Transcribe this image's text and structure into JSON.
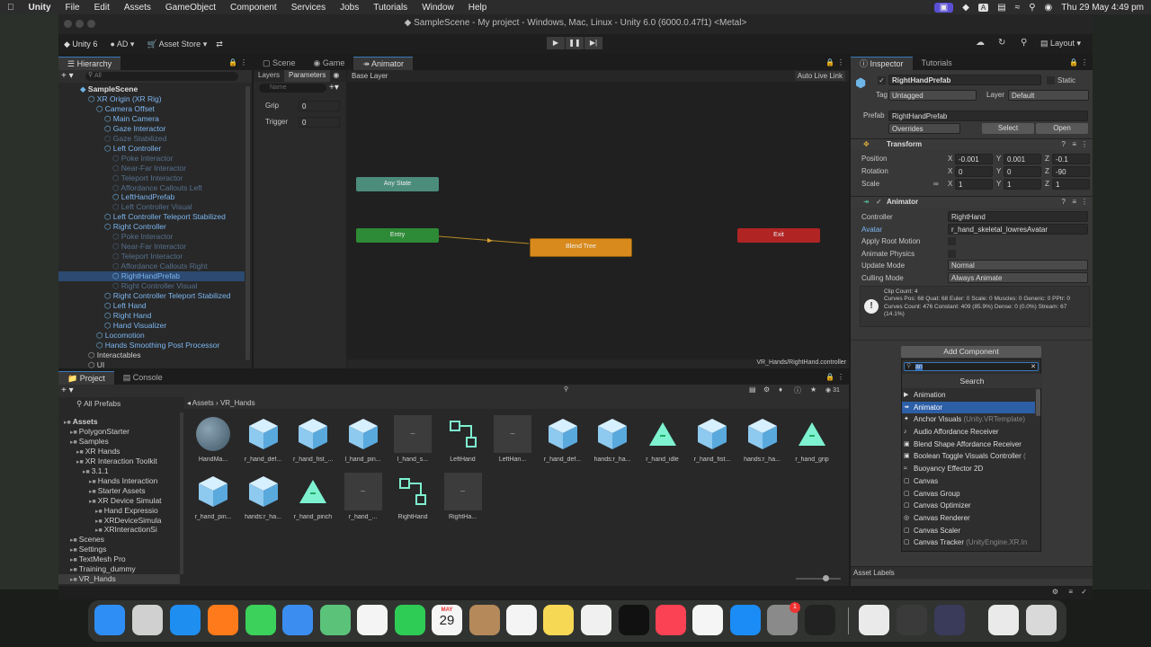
{
  "menubar": {
    "app": "Unity",
    "items": [
      "File",
      "Edit",
      "Assets",
      "GameObject",
      "Component",
      "Services",
      "Jobs",
      "Tutorials",
      "Window",
      "Help"
    ],
    "datetime": "Thu 29 May  4:49 pm"
  },
  "window": {
    "title": "SampleScene - My project - Windows, Mac, Linux - Unity 6.0 (6000.0.47f1) <Metal>"
  },
  "toolbar": {
    "unity": "Unity 6",
    "account": "AD",
    "asset_store": "Asset Store",
    "layout": "Layout"
  },
  "hierarchy": {
    "tab": "Hierarchy",
    "search_placeholder": "All",
    "items": [
      {
        "label": "SampleScene",
        "depth": 0,
        "style": "scene"
      },
      {
        "label": "XR Origin (XR Rig)",
        "depth": 1,
        "style": "blue"
      },
      {
        "label": "Camera Offset",
        "depth": 2,
        "style": "blue"
      },
      {
        "label": "Main Camera",
        "depth": 3,
        "style": "blue"
      },
      {
        "label": "Gaze Interactor",
        "depth": 3,
        "style": "blue"
      },
      {
        "label": "Gaze Stabilized",
        "depth": 3,
        "style": "dim"
      },
      {
        "label": "Left Controller",
        "depth": 3,
        "style": "blue"
      },
      {
        "label": "Poke Interactor",
        "depth": 4,
        "style": "dim"
      },
      {
        "label": "Near-Far Interactor",
        "depth": 4,
        "style": "dim"
      },
      {
        "label": "Teleport Interactor",
        "depth": 4,
        "style": "dim"
      },
      {
        "label": "Affordance Callouts Left",
        "depth": 4,
        "style": "dim"
      },
      {
        "label": "LeftHandPrefab",
        "depth": 4,
        "style": "blue"
      },
      {
        "label": "Left Controller Visual",
        "depth": 4,
        "style": "dim"
      },
      {
        "label": "Left Controller Teleport Stabilized",
        "depth": 3,
        "style": "blue"
      },
      {
        "label": "Right Controller",
        "depth": 3,
        "style": "blue"
      },
      {
        "label": "Poke Interactor",
        "depth": 4,
        "style": "dim"
      },
      {
        "label": "Near-Far Interactor",
        "depth": 4,
        "style": "dim"
      },
      {
        "label": "Teleport Interactor",
        "depth": 4,
        "style": "dim"
      },
      {
        "label": "Affordance Callouts Right",
        "depth": 4,
        "style": "dim"
      },
      {
        "label": "RightHandPrefab",
        "depth": 4,
        "style": "blue sel"
      },
      {
        "label": "Right Controller Visual",
        "depth": 4,
        "style": "dim"
      },
      {
        "label": "Right Controller Teleport Stabilized",
        "depth": 3,
        "style": "blue"
      },
      {
        "label": "Left Hand",
        "depth": 3,
        "style": "blue"
      },
      {
        "label": "Right Hand",
        "depth": 3,
        "style": "blue"
      },
      {
        "label": "Hand Visualizer",
        "depth": 3,
        "style": "blue"
      },
      {
        "label": "Locomotion",
        "depth": 2,
        "style": "blue"
      },
      {
        "label": "Hands Smoothing Post Processor",
        "depth": 2,
        "style": "blue"
      },
      {
        "label": "Interactables",
        "depth": 1,
        "style": "plain"
      },
      {
        "label": "UI",
        "depth": 1,
        "style": "plain"
      }
    ]
  },
  "animator": {
    "tabs": [
      "Scene",
      "Game",
      "Animator"
    ],
    "subtabs": [
      "Layers",
      "Parameters"
    ],
    "base_layer": "Base Layer",
    "auto_live_link": "Auto Live Link",
    "search_placeholder": "Name",
    "parameters": [
      {
        "name": "Grip",
        "value": "0"
      },
      {
        "name": "Trigger",
        "value": "0"
      }
    ],
    "nodes": {
      "any_state": "Any State",
      "entry": "Entry",
      "blend_tree": "Blend Tree",
      "exit": "Exit"
    },
    "footer": "VR_Hands/RightHand.controller"
  },
  "project": {
    "tabs": [
      "Project",
      "Console"
    ],
    "favorites": "All Prefabs",
    "breadcrumb": [
      "Assets",
      "VR_Hands"
    ],
    "count": "31",
    "tree": [
      {
        "label": "Assets",
        "depth": 0
      },
      {
        "label": "PolygonStarter",
        "depth": 1
      },
      {
        "label": "Samples",
        "depth": 1
      },
      {
        "label": "XR Hands",
        "depth": 2
      },
      {
        "label": "XR Interaction Toolkit",
        "depth": 2
      },
      {
        "label": "3.1.1",
        "depth": 3
      },
      {
        "label": "Hands Interaction",
        "depth": 4
      },
      {
        "label": "Starter Assets",
        "depth": 4
      },
      {
        "label": "XR Device Simulat",
        "depth": 4
      },
      {
        "label": "Hand Expressio",
        "depth": 5
      },
      {
        "label": "XRDeviceSimula",
        "depth": 5
      },
      {
        "label": "XRInteractionSi",
        "depth": 5
      },
      {
        "label": "Scenes",
        "depth": 1
      },
      {
        "label": "Settings",
        "depth": 1
      },
      {
        "label": "TextMesh Pro",
        "depth": 1
      },
      {
        "label": "Training_dummy",
        "depth": 1
      },
      {
        "label": "VR_Hands",
        "depth": 1
      }
    ],
    "assets": [
      {
        "label": "HandMa...",
        "kind": "sphere"
      },
      {
        "label": "r_hand_def...",
        "kind": "cube"
      },
      {
        "label": "r_hand_fist_...",
        "kind": "cube"
      },
      {
        "label": "l_hand_pin...",
        "kind": "cube"
      },
      {
        "label": "l_hand_s...",
        "kind": "anim"
      },
      {
        "label": "LeftHand",
        "kind": "ctrl"
      },
      {
        "label": "LeftHan...",
        "kind": "anim"
      },
      {
        "label": "r_hand_def...",
        "kind": "cube"
      },
      {
        "label": "hands:r_ha...",
        "kind": "cube"
      },
      {
        "label": "r_hand_idle",
        "kind": "tri"
      },
      {
        "label": "r_hand_fist...",
        "kind": "cube"
      },
      {
        "label": "hands:r_ha...",
        "kind": "cube"
      },
      {
        "label": "r_hand_grip",
        "kind": "tri"
      },
      {
        "label": "r_hand_pin...",
        "kind": "cube"
      },
      {
        "label": "hands:r_ha...",
        "kind": "cube"
      },
      {
        "label": "r_hand_pinch",
        "kind": "tri"
      },
      {
        "label": "r_hand_...",
        "kind": "anim"
      },
      {
        "label": "RightHand",
        "kind": "ctrl"
      },
      {
        "label": "RightHa...",
        "kind": "anim"
      }
    ]
  },
  "inspector": {
    "tabs": [
      "Inspector",
      "Tutorials"
    ],
    "object_name": "RightHandPrefab",
    "static": "Static",
    "tag_label": "Tag",
    "tag": "Untagged",
    "layer_label": "Layer",
    "layer": "Default",
    "prefab_label": "Prefab",
    "prefab": "RightHandPrefab",
    "overrides": "Overrides",
    "select": "Select",
    "open": "Open",
    "transform": {
      "title": "Transform",
      "position_label": "Position",
      "position": [
        "-0.001",
        "0.001",
        "-0.1"
      ],
      "rotation_label": "Rotation",
      "rotation": [
        "0",
        "0",
        "-90"
      ],
      "scale_label": "Scale",
      "scale": [
        "1",
        "1",
        "1"
      ]
    },
    "animator": {
      "title": "Animator",
      "controller_label": "Controller",
      "controller": "RightHand",
      "avatar_label": "Avatar",
      "avatar": "r_hand_skeletal_lowresAvatar",
      "apply_root_motion": "Apply Root Motion",
      "animate_physics": "Animate Physics",
      "update_mode_label": "Update Mode",
      "update_mode": "Normal",
      "culling_mode_label": "Culling Mode",
      "culling_mode": "Always Animate",
      "info": "Clip Count: 4\nCurves Pos: 68 Quat: 68 Euler: 0 Scale: 0 Muscles: 0 Generic: 0 PPtr: 0\nCurves Count: 476 Constant: 409 (85.9%) Dense: 0 (0.0%) Stream: 67 (14.1%)"
    },
    "add_component": "Add Component",
    "search_value": "an",
    "search_title": "Search",
    "results": [
      {
        "label": "Animation",
        "suffix": ""
      },
      {
        "label": "Animator",
        "suffix": ""
      },
      {
        "label": "Anchor Visuals",
        "suffix": " (Unity.VRTemplate)"
      },
      {
        "label": "Audio Affordance Receiver",
        "suffix": ""
      },
      {
        "label": "Blend Shape Affordance Receiver",
        "suffix": ""
      },
      {
        "label": "Boolean Toggle Visuals Controller",
        "suffix": " ("
      },
      {
        "label": "Buoyancy Effector 2D",
        "suffix": ""
      },
      {
        "label": "Canvas",
        "suffix": ""
      },
      {
        "label": "Canvas Group",
        "suffix": ""
      },
      {
        "label": "Canvas Optimizer",
        "suffix": ""
      },
      {
        "label": "Canvas Renderer",
        "suffix": ""
      },
      {
        "label": "Canvas Scaler",
        "suffix": ""
      },
      {
        "label": "Canvas Tracker",
        "suffix": " (UnityEngine.XR.In"
      }
    ],
    "asset_labels": "Asset Labels"
  },
  "dock": {
    "calendar_month": "MAY",
    "calendar_day": "29",
    "badge": "1"
  }
}
